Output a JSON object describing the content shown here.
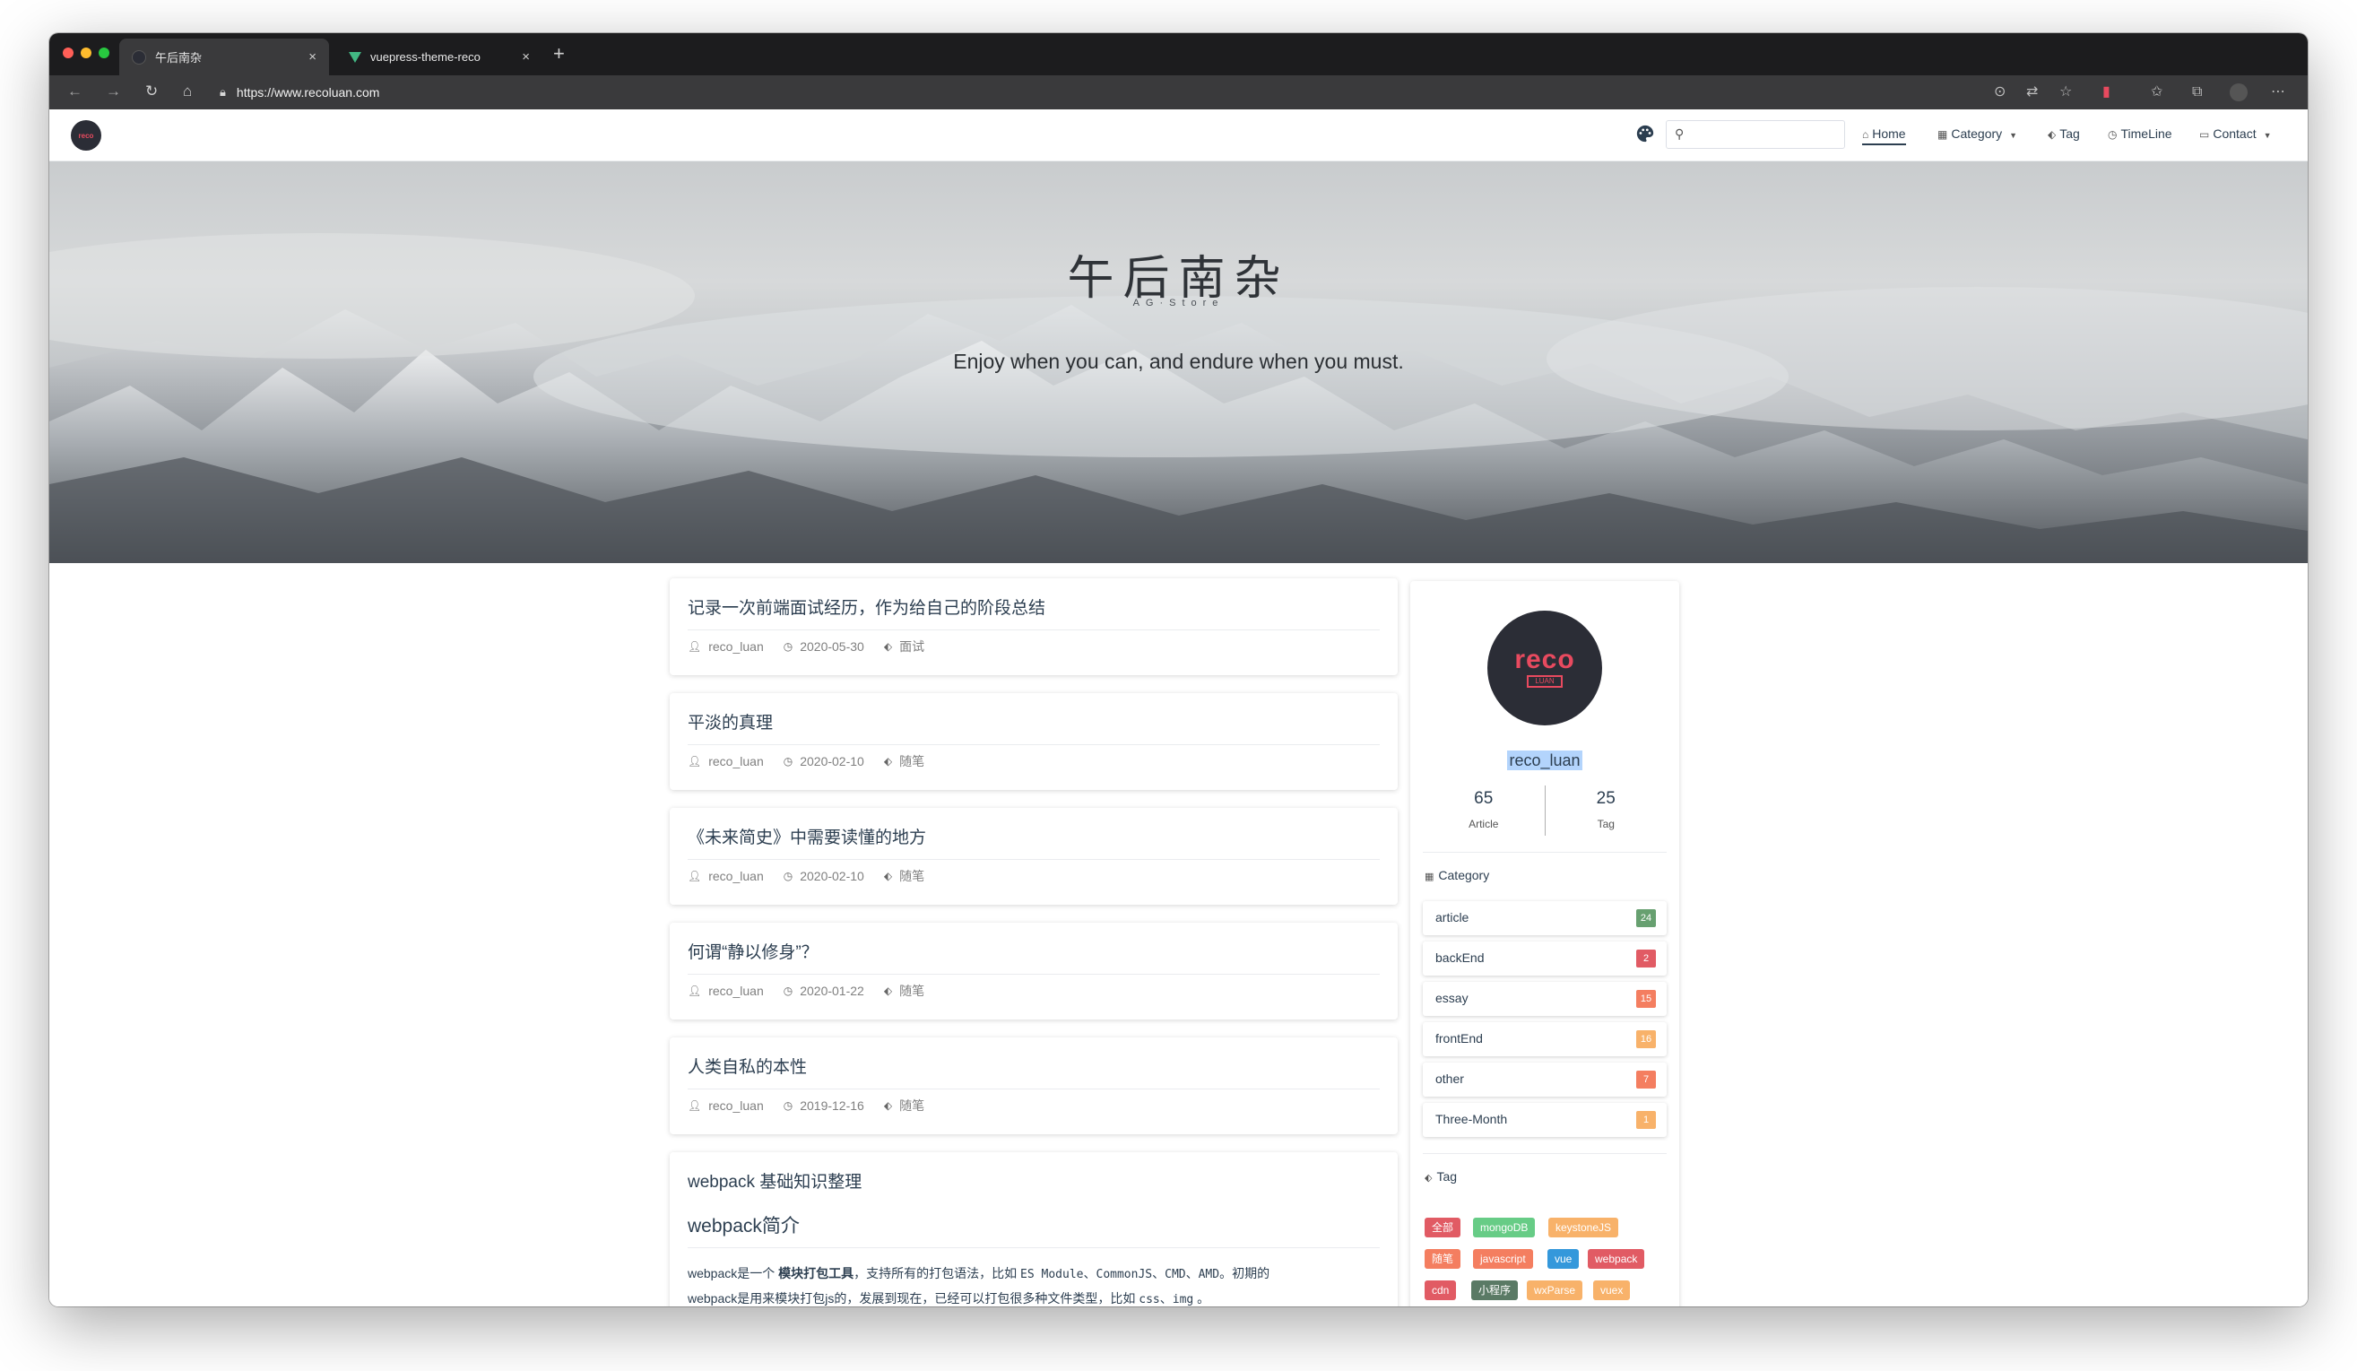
{
  "browser": {
    "tabs": [
      {
        "title": "午后南杂",
        "close": "×",
        "active": true
      },
      {
        "title": "vuepress-theme-reco",
        "close": "×",
        "active": false
      }
    ],
    "new_tab": "+",
    "url": "https://www.recoluan.com",
    "colors": {
      "close": "#ff5f57",
      "minimize": "#febc2e",
      "zoom": "#28c840"
    }
  },
  "navbar": {
    "logo_text": "reco",
    "search_placeholder": "",
    "items": [
      {
        "label": "Home",
        "icon": "home-icon",
        "active": true
      },
      {
        "label": "Category",
        "icon": "grid-icon",
        "dropdown": true
      },
      {
        "label": "Tag",
        "icon": "tag-icon"
      },
      {
        "label": "TimeLine",
        "icon": "clock-icon"
      },
      {
        "label": "Contact",
        "icon": "contact-icon",
        "dropdown": true
      }
    ]
  },
  "hero": {
    "title": "午后南杂",
    "subtitle": "AG·Store",
    "description": "Enjoy when you can, and endure when you must."
  },
  "posts": [
    {
      "title": "记录一次前端面试经历，作为给自己的阶段总结",
      "author": "reco_luan",
      "date": "2020-05-30",
      "tag": "面试"
    },
    {
      "title": "平淡的真理",
      "author": "reco_luan",
      "date": "2020-02-10",
      "tag": "随笔"
    },
    {
      "title": "《未来简史》中需要读懂的地方",
      "author": "reco_luan",
      "date": "2020-02-10",
      "tag": "随笔"
    },
    {
      "title": "何谓“静以修身”？",
      "author": "reco_luan",
      "date": "2020-01-22",
      "tag": "随笔"
    },
    {
      "title": "人类自私的本性",
      "author": "reco_luan",
      "date": "2019-12-16",
      "tag": "随笔"
    }
  ],
  "webpack_post": {
    "title": "webpack 基础知识整理",
    "heading": "webpack简介",
    "p1_a": "webpack是一个 ",
    "p1_b": "模块打包工具",
    "p1_c": "，支持所有的打包语法，比如 ",
    "p1_d": "ES Module",
    "p1_e": "、",
    "p1_f": "CommonJS",
    "p1_g": "、",
    "p1_h": "CMD",
    "p1_i": "、",
    "p1_j": "AMD",
    "p1_k": "。初期的",
    "p2_a": "webpack是用来模块打包js的，发展到现在，已经可以打包很多种文件类型，比如 ",
    "p2_b": "css",
    "p2_c": "、",
    "p2_d": "img",
    "p2_e": " 。"
  },
  "profile": {
    "avatar_text": "reco",
    "avatar_sub": "LUAN",
    "name": "reco_luan",
    "article_count": "65",
    "article_label": "Article",
    "tag_count": "25",
    "tag_label": "Tag"
  },
  "categories": {
    "heading": "Category",
    "items": [
      {
        "name": "article",
        "count": "24",
        "color": "#67a070"
      },
      {
        "name": "backEnd",
        "count": "2",
        "color": "#e15b64"
      },
      {
        "name": "essay",
        "count": "15",
        "color": "#f47e60"
      },
      {
        "name": "frontEnd",
        "count": "16",
        "color": "#f8b26a"
      },
      {
        "name": "other",
        "count": "7",
        "color": "#f47e60"
      },
      {
        "name": "Three-Month",
        "count": "1",
        "color": "#f8b26a"
      }
    ]
  },
  "tags": {
    "heading": "Tag",
    "items": [
      {
        "label": "全部",
        "color": "#e15b64"
      },
      {
        "label": "mongoDB",
        "color": "#67cc86"
      },
      {
        "label": "keystoneJS",
        "color": "#f8b26a"
      },
      {
        "label": "随笔",
        "color": "#f47e60"
      },
      {
        "label": "javascript",
        "color": "#f47e60"
      },
      {
        "label": "vue",
        "color": "#3498db"
      },
      {
        "label": "webpack",
        "color": "#e15b64"
      },
      {
        "label": "cdn",
        "color": "#e15b64"
      },
      {
        "label": "小程序",
        "color": "#5a7a65"
      },
      {
        "label": "wxParse",
        "color": "#f8b26a"
      },
      {
        "label": "vuex",
        "color": "#f8b26a"
      }
    ]
  }
}
